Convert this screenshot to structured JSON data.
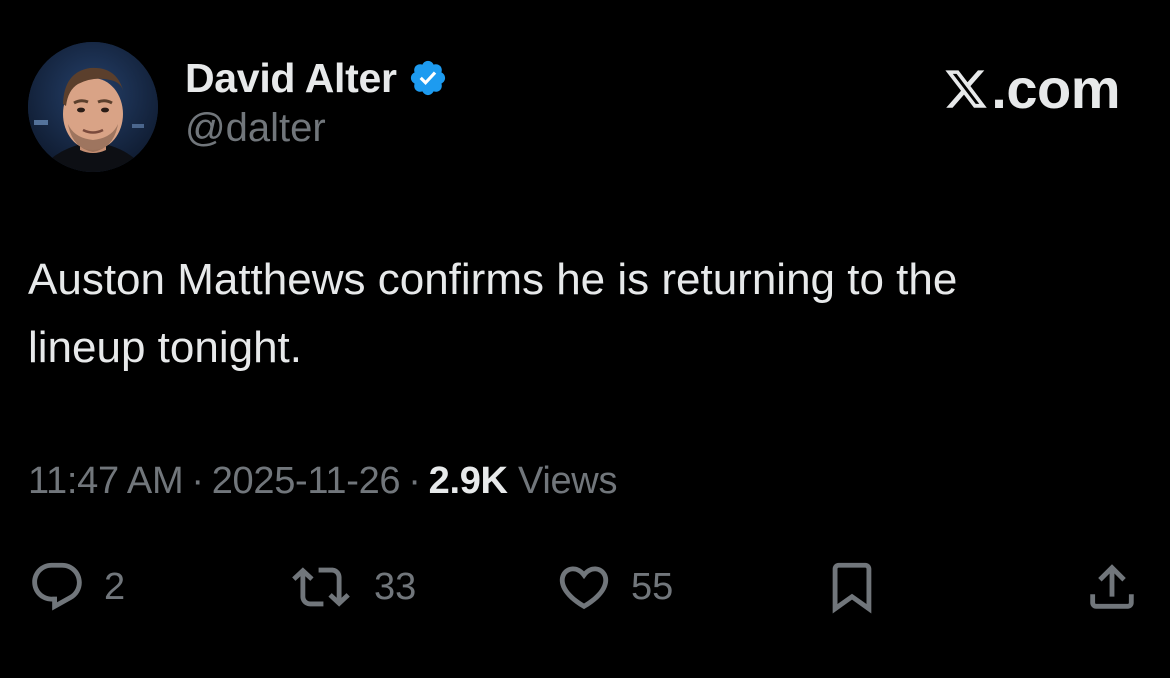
{
  "author": {
    "display_name": "David Alter",
    "handle": "@dalter",
    "avatar_icon": "profile-photo",
    "verified_icon": "verified-badge-icon"
  },
  "brand": {
    "label": ".com",
    "logo_icon": "x-logo-icon"
  },
  "tweet": {
    "text": "Auston Matthews confirms he is returning to the\nlineup tonight."
  },
  "meta": {
    "time": "11:47 AM",
    "separator": "·",
    "date": "2025-11-26",
    "views_count": "2.9K",
    "views_label": "Views"
  },
  "actions": {
    "replies": "2",
    "reposts": "33",
    "likes": "55"
  },
  "colors": {
    "background": "#000000",
    "text_primary": "#e7e9ea",
    "text_secondary": "#71767b",
    "verified_blue": "#1d9bf0"
  }
}
